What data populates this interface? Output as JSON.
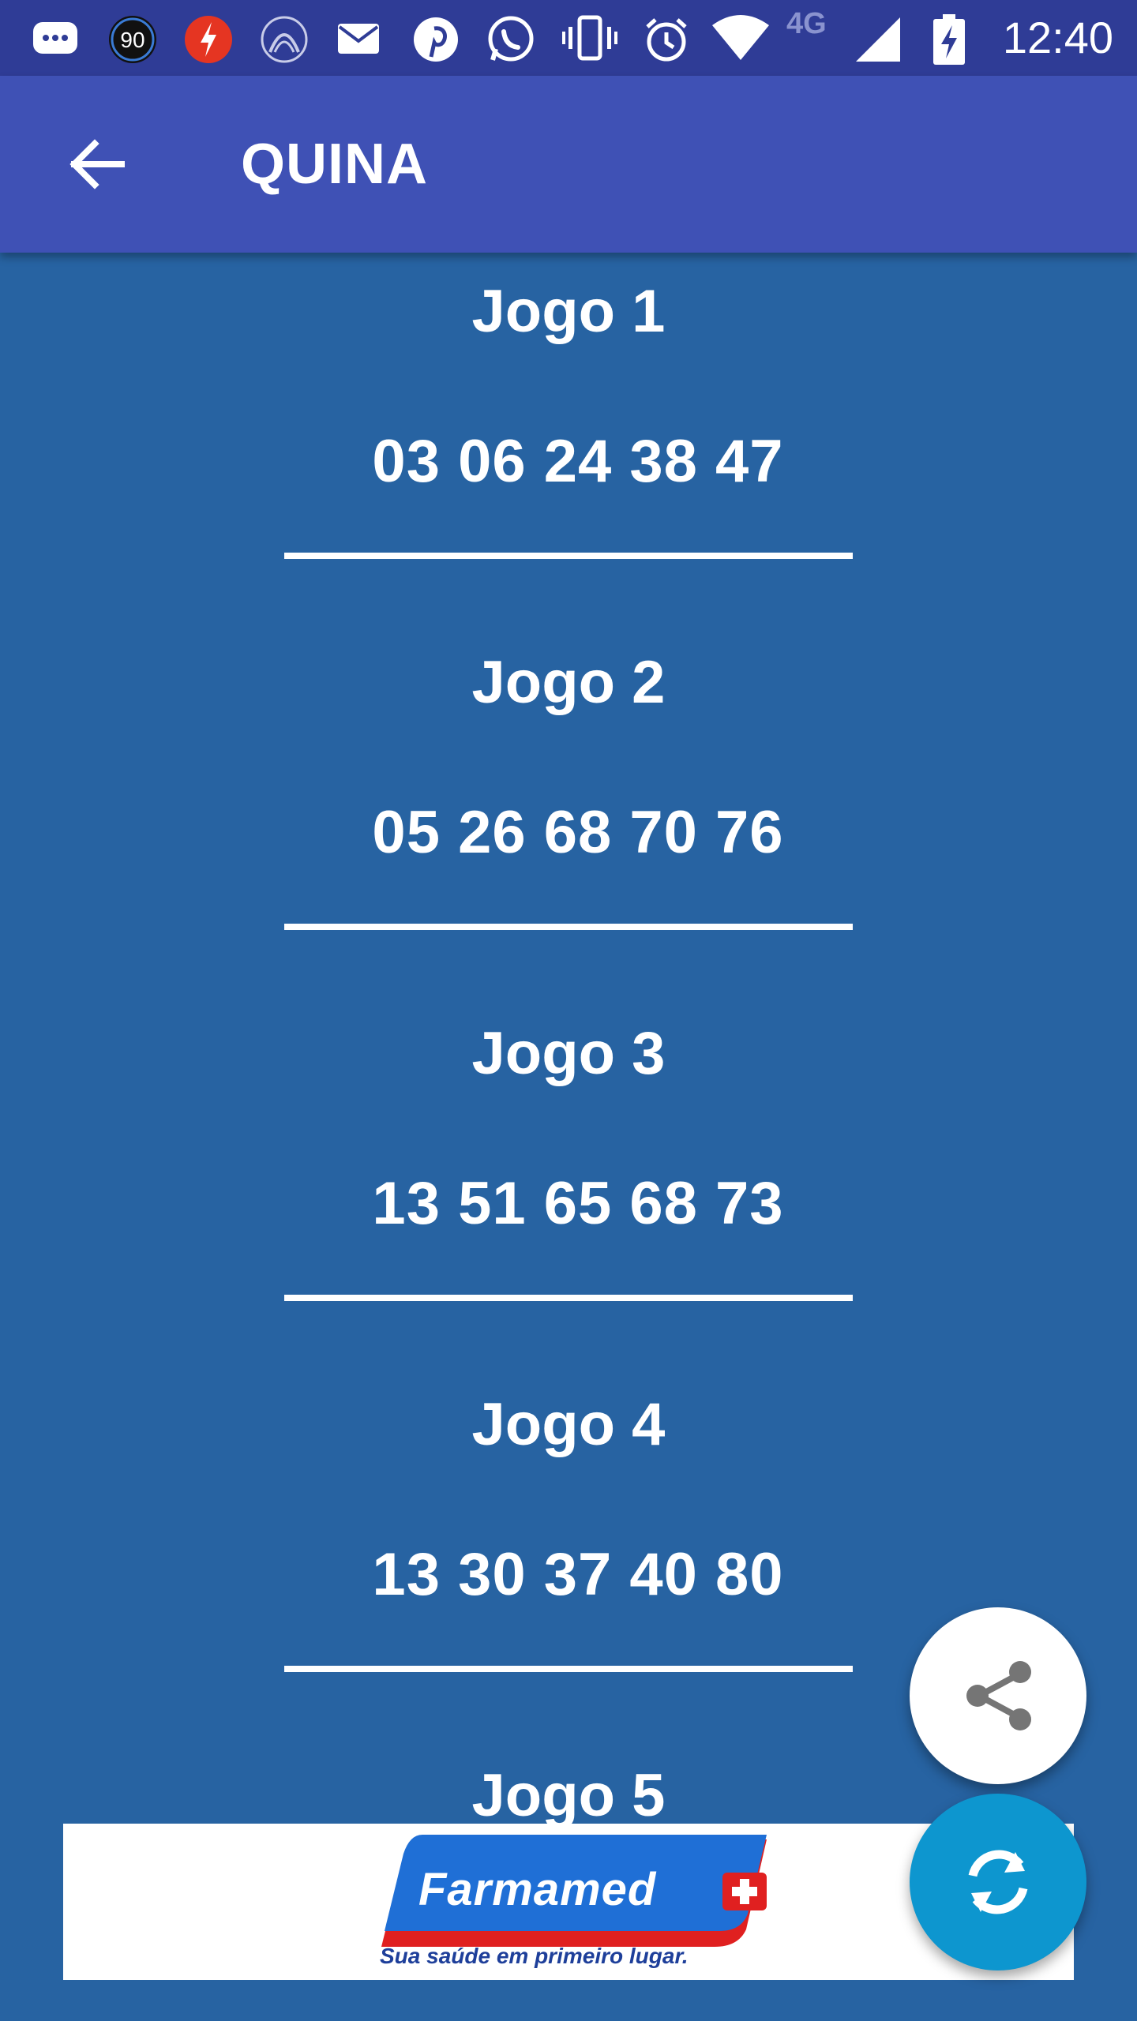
{
  "status_bar": {
    "time": "12:40",
    "ninety_badge": "90",
    "network_label": "4G",
    "icons": [
      "messages-icon",
      "ninety-badge-icon",
      "flash-app-icon",
      "arc-app-icon",
      "gmail-icon",
      "pinterest-icon",
      "whatsapp-icon",
      "vibrate-icon",
      "alarm-icon",
      "wifi-icon",
      "network-4g-icon",
      "signal-icon",
      "battery-charging-icon"
    ]
  },
  "app_bar": {
    "title": "QUINA",
    "back_icon": "arrow-back-icon"
  },
  "games": [
    {
      "title": "Jogo 1",
      "numbers": "03 06 24 38 47"
    },
    {
      "title": "Jogo 2",
      "numbers": "05 26 68 70 76"
    },
    {
      "title": "Jogo 3",
      "numbers": "13 51 65 68 73"
    },
    {
      "title": "Jogo 4",
      "numbers": "13 30 37 40 80"
    },
    {
      "title": "Jogo 5",
      "numbers": ""
    }
  ],
  "ad": {
    "brand": "Farmamed",
    "slogan": "Sua saúde em primeiro lugar."
  },
  "fab": {
    "share_icon": "share-icon",
    "refresh_icon": "refresh-icon"
  },
  "colors": {
    "status_bar": "#2f3c96",
    "app_bar": "#3f51b5",
    "background": "#2763a2",
    "fab_refresh": "#0d96cf",
    "fab_share": "#ffffff",
    "ad_blue": "#1f6fd6",
    "ad_red": "#e02020"
  }
}
